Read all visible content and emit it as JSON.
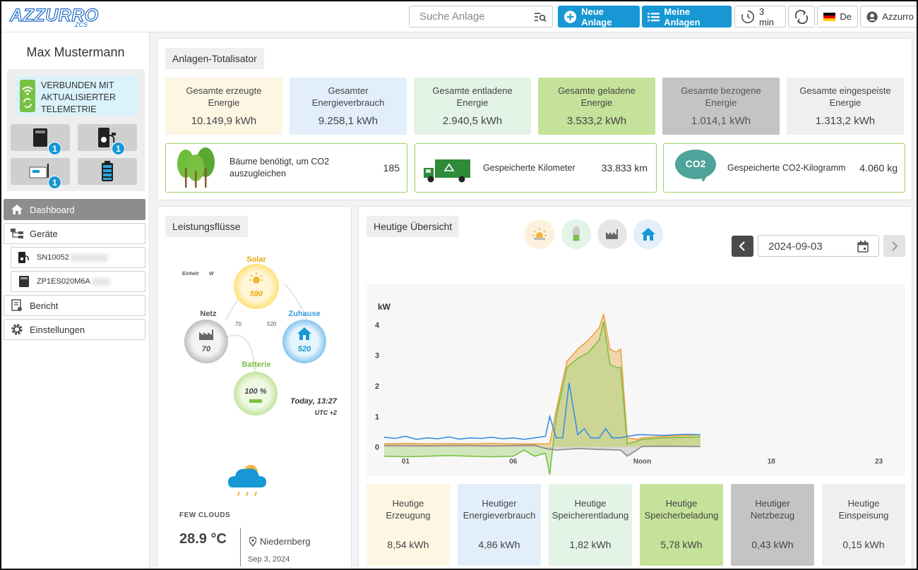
{
  "header": {
    "logo_text": "AZZURRO",
    "logo_sub": "ZCS",
    "search_placeholder": "Suche Anlage",
    "new_plant_label": "Neue Anlage",
    "my_plants_label": "Meine Anlagen",
    "refresh_interval": "3 min",
    "language": "De",
    "account_label": "Azzurro",
    "accent_color": "#1797d3"
  },
  "sidebar": {
    "user_name": "Max Mustermann",
    "connection_status": "VERBUNDEN MIT AKTUALISIERTER TELEMETRIE",
    "device_badges": [
      "1",
      "1",
      "1"
    ],
    "nav": {
      "dashboard": "Dashboard",
      "devices": "Geräte",
      "device_1": "SN10052",
      "device_2": "ZP1ES020M6A",
      "report": "Bericht",
      "settings": "Einstellungen"
    }
  },
  "totalizer": {
    "title": "Anlagen-Totalisator",
    "tiles": [
      {
        "label": "Gesamte erzeugte Energie",
        "value": "10.149,9 kWh",
        "color": "#fdf6e3"
      },
      {
        "label": "Gesamter Energieverbrauch",
        "value": "9.258,1 kWh",
        "color": "#e2effb"
      },
      {
        "label": "Gesamte entladene Energie",
        "value": "2.940,5 kWh",
        "color": "#e3f3e6"
      },
      {
        "label": "Gesamte geladene Energie",
        "value": "3.533,2 kWh",
        "color": "#c5e29a"
      },
      {
        "label": "Gesamte bezogene Energie",
        "value": "1.014,1 kWh",
        "color": "#c4c4c4"
      },
      {
        "label": "Gesamte eingespeiste Energie",
        "value": "1.313,2 kWh",
        "color": "#efefef"
      }
    ],
    "env": {
      "trees_label": "Bäume benötigt, um CO2 auszugleichen",
      "trees_value": "185",
      "km_label": "Gespeicherte Kilometer",
      "km_value": "33.833 km",
      "co2_label": "Gespeicherte CO2-Kilogramm",
      "co2_value": "4.060 kg",
      "co2_icon_text": "CO2"
    }
  },
  "flows": {
    "title": "Leistungsflüsse",
    "unit_label": "Einheit",
    "unit_value": "W",
    "solar_label": "Solar",
    "solar_value": "590",
    "grid_label": "Netz",
    "grid_value": "70",
    "home_label": "Zuhause",
    "home_value": "520",
    "battery_label": "Batterie",
    "battery_value": "100 %",
    "flow_grid": "70",
    "flow_home": "520",
    "time": "Today, 13:27",
    "tz": "UTC +2",
    "weather": "FEW CLOUDS",
    "temperature": "28.9 °C",
    "location": "Niedernberg",
    "date": "Sep 3, 2024"
  },
  "overview": {
    "title": "Heutige Übersicht",
    "date_value": "2024-09-03",
    "filter_icons": [
      "solar-icon",
      "battery-icon",
      "grid-icon",
      "home-icon"
    ],
    "tiles": [
      {
        "label": "Heutige Erzeugung",
        "value": "8,54 kWh",
        "color": "#fdf6e3"
      },
      {
        "label": "Heutiger Energieverbrauch",
        "value": "4,86 kWh",
        "color": "#e2effb"
      },
      {
        "label": "Heutige Speicherentladung",
        "value": "1,82 kWh",
        "color": "#e3f3e6"
      },
      {
        "label": "Heutige Speicherbeladung",
        "value": "5,78 kWh",
        "color": "#c5e29a"
      },
      {
        "label": "Heutiger Netzbezug",
        "value": "0,43 kWh",
        "color": "#c4c4c4"
      },
      {
        "label": "Heutige Einspeisung",
        "value": "0,15 kWh",
        "color": "#efefef"
      }
    ]
  },
  "chart_data": {
    "type": "area",
    "ylabel": "kW",
    "xlim": [
      0,
      24
    ],
    "ylim": [
      -0.4,
      4.4
    ],
    "yticks": [
      0,
      1,
      2,
      3,
      4
    ],
    "xticks": [
      {
        "x": 1,
        "label": "01"
      },
      {
        "x": 6,
        "label": "06"
      },
      {
        "x": 12,
        "label": "Noon"
      },
      {
        "x": 18,
        "label": "18"
      },
      {
        "x": 23,
        "label": "23"
      }
    ],
    "series": [
      {
        "key": "production",
        "color": "#f0a040",
        "fill": "rgba(232,176,80,0.45)",
        "x": [
          0,
          1,
          2,
          3,
          4,
          5,
          6,
          7,
          7.7,
          8,
          8.5,
          9,
          9.5,
          10,
          10.2,
          10.5,
          10.8,
          11,
          11.3,
          11.8,
          12,
          13,
          14,
          14.7
        ],
        "y": [
          0.1,
          0.12,
          0.1,
          0.11,
          0.1,
          0.12,
          0.1,
          0.1,
          0.1,
          1.2,
          2.8,
          3.2,
          3.5,
          3.9,
          4.35,
          3.2,
          3.1,
          3.2,
          0.3,
          0.25,
          0.3,
          0.35,
          0.38,
          0.4
        ]
      },
      {
        "key": "battery",
        "color": "#7ac143",
        "fill": "rgba(160,210,120,0.45)",
        "x": [
          0,
          1,
          2,
          3,
          4,
          5,
          6,
          6.5,
          7,
          7.5,
          7.7,
          8,
          8.5,
          9,
          9.5,
          10,
          10.2,
          10.5,
          10.8,
          11,
          11.3,
          11.8,
          12,
          13,
          14,
          14.7
        ],
        "y": [
          -0.3,
          -0.32,
          -0.3,
          -0.28,
          -0.3,
          -0.32,
          -0.3,
          -0.1,
          -0.3,
          -0.2,
          -0.9,
          1.0,
          2.6,
          2.9,
          3.1,
          3.5,
          4.1,
          2.7,
          2.6,
          2.6,
          0.1,
          0.2,
          0.25,
          0.3,
          0.32,
          0.33
        ]
      },
      {
        "key": "consumption",
        "color": "#3a8ee6",
        "fill": "none",
        "x": [
          0,
          0.5,
          1,
          1.5,
          2,
          2.5,
          3,
          3.5,
          4,
          4.5,
          5,
          5.5,
          6,
          6.5,
          7,
          7.5,
          7.7,
          8,
          8.3,
          8.6,
          9,
          9.3,
          9.6,
          10,
          10.3,
          10.6,
          11,
          11.3,
          11.8,
          12,
          13,
          14,
          14.7
        ],
        "y": [
          0.32,
          0.28,
          0.35,
          0.25,
          0.3,
          0.27,
          0.33,
          0.26,
          0.3,
          0.28,
          0.32,
          0.27,
          0.3,
          0.25,
          0.3,
          0.35,
          1.0,
          0.3,
          0.3,
          2.1,
          0.4,
          0.6,
          0.3,
          0.3,
          0.6,
          0.3,
          0.3,
          0.35,
          0.4,
          0.4,
          0.38,
          0.42,
          0.4
        ]
      },
      {
        "key": "grid",
        "color": "#888888",
        "fill": "rgba(160,160,160,0.35)",
        "x": [
          0,
          1,
          2,
          3,
          4,
          5,
          6,
          7,
          7.5,
          8,
          9,
          10,
          11,
          11.3,
          12,
          13,
          14,
          14.7
        ],
        "y": [
          0.05,
          0.05,
          0.04,
          0.05,
          0.05,
          0.04,
          0.05,
          0.06,
          -0.05,
          -0.1,
          -0.05,
          -0.08,
          -0.1,
          -0.3,
          0.02,
          0.03,
          0.02,
          0.02
        ]
      }
    ]
  }
}
